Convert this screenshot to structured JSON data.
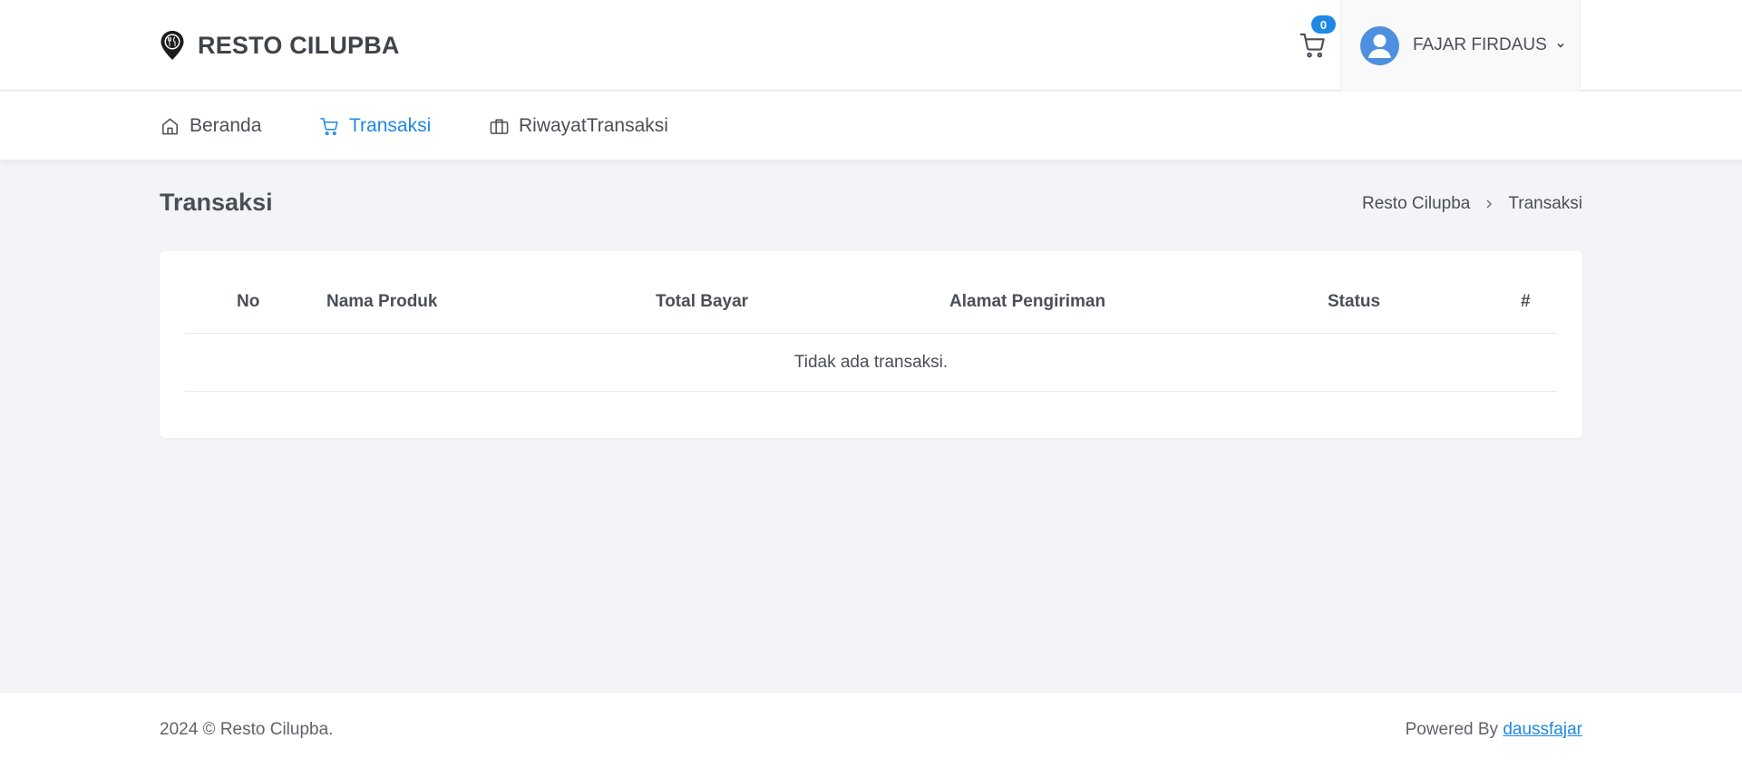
{
  "brand": {
    "name": "RESTO CILUPBA"
  },
  "cart": {
    "count": "0"
  },
  "user": {
    "name": "FAJAR FIRDAUS"
  },
  "nav": {
    "items": [
      {
        "label": "Beranda",
        "icon": "home-icon",
        "active": false
      },
      {
        "label": "Transaksi",
        "icon": "cart-icon",
        "active": true
      },
      {
        "label": "RiwayatTransaksi",
        "icon": "briefcase-icon",
        "active": false
      }
    ]
  },
  "page": {
    "title": "Transaksi"
  },
  "breadcrumb": {
    "items": [
      "Resto Cilupba",
      "Transaksi"
    ]
  },
  "table": {
    "columns": [
      "No",
      "Nama Produk",
      "Total Bayar",
      "Alamat Pengiriman",
      "Status",
      "#"
    ],
    "empty_message": "Tidak ada transaksi."
  },
  "footer": {
    "copyright": "2024 © Resto Cilupba.",
    "powered_by_label": "Powered By ",
    "powered_by_link": "daussfajar"
  },
  "colors": {
    "accent": "#1e88e5",
    "background": "#f3f4f7",
    "text": "#4a4f57"
  }
}
